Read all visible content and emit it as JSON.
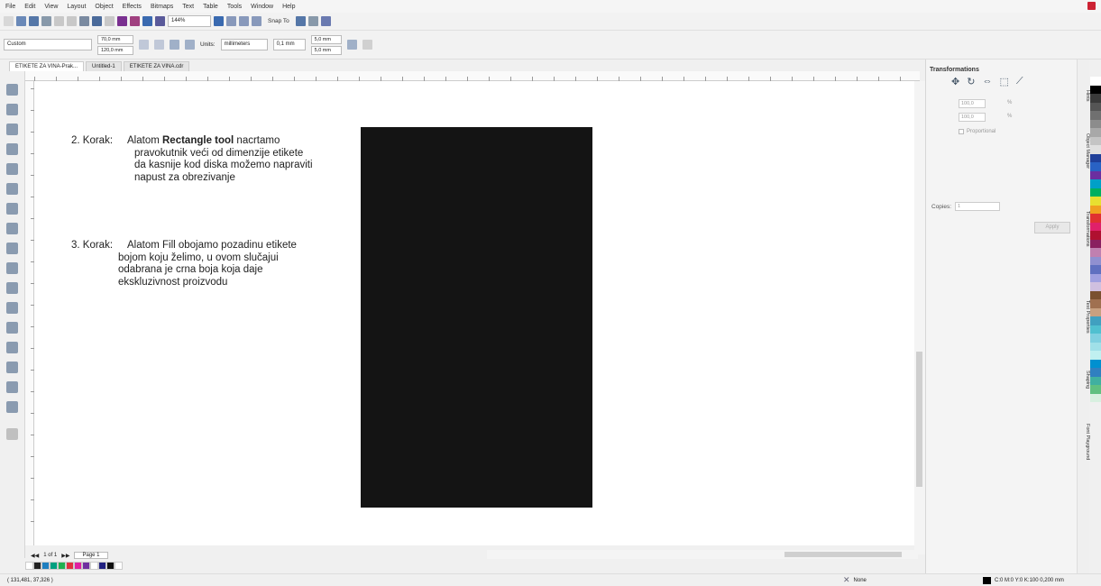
{
  "menu": [
    "File",
    "Edit",
    "View",
    "Layout",
    "Object",
    "Effects",
    "Bitmaps",
    "Text",
    "Table",
    "Tools",
    "Window",
    "Help"
  ],
  "toolbar": {
    "zoom": "144%",
    "snap_to": "Snap To"
  },
  "propbar": {
    "page_preset": "Custom",
    "width": "70,0 mm",
    "height": "120,0 mm",
    "units_label": "Units:",
    "units_value": "millimeters",
    "nudge": "0,1 mm",
    "dup_x": "5,0 mm",
    "dup_y": "5,0 mm"
  },
  "tabs": [
    "ETIKETE ZA VINA-Prak...",
    "Untitled-1",
    "ETIKETE ZA VINA.cdr"
  ],
  "canvas": {
    "step2": {
      "label": "2. Korak:",
      "line1_prefix": "Alatom ",
      "line1_bold": "Rectangle tool",
      "line1_suffix": " nacrtamo",
      "line2": "pravokutnik veći od dimenzije etikete",
      "line3": "da kasnije kod diska možemo napraviti",
      "line4": "napust za obrezivanje"
    },
    "step3": {
      "label": "3. Korak:",
      "line1": "Alatom Fill obojamo pozadinu etikete",
      "line2": "bojom koju želimo, u ovom slučajui",
      "line3": "odabrana je crna boja koja daje",
      "line4": "ekskluzivnost proizvodu"
    },
    "rect_color": "#141414"
  },
  "page_nav": {
    "counter": "1 of 1",
    "page_tab": "Page 1"
  },
  "panel": {
    "title": "Transformations",
    "x": "100,0",
    "y": "100,0",
    "pct": "%",
    "proportional": "Proportional",
    "copies_label": "Copies:",
    "copies_value": "1",
    "apply": "Apply"
  },
  "dock_tabs": [
    "Hints",
    "Object Manager",
    "Transformations",
    "Text Properties",
    "Shaping",
    "Font Playground"
  ],
  "status": {
    "coords": "( 131,481, 37,326 )",
    "fill_label": "None",
    "color_info": "C:0 M:0 Y:0 K:100  0,200 mm"
  },
  "colors": {
    "palette_right": [
      "#ffffff",
      "#000000",
      "#3a3a3a",
      "#555555",
      "#707070",
      "#8c8c8c",
      "#a8a8a8",
      "#c4c4c4",
      "#e0e0e0",
      "#1f3f99",
      "#2962c4",
      "#6b2fa0",
      "#00a0c8",
      "#00b060",
      "#e8e030",
      "#f0a020",
      "#e03030",
      "#e0206a",
      "#b01030",
      "#8a2060",
      "#c080b0",
      "#9090d0",
      "#6070c0",
      "#a0a0e0",
      "#d0c0e0",
      "#7a5030",
      "#a07050",
      "#c8a080",
      "#40a0c0",
      "#50c0d0",
      "#80d0e0",
      "#a0e0e8",
      "#c0f0f0",
      "#0090d0",
      "#3080c0",
      "#40b0a0",
      "#60c080",
      "#d8f0e0"
    ],
    "palette_bottom": [
      "#ffffff",
      "#222222",
      "#1f7fc0",
      "#00a080",
      "#20b050",
      "#e03040",
      "#e020a0",
      "#7030a0",
      "#ffffff",
      "#202080",
      "#101010",
      "#ffffff"
    ]
  }
}
